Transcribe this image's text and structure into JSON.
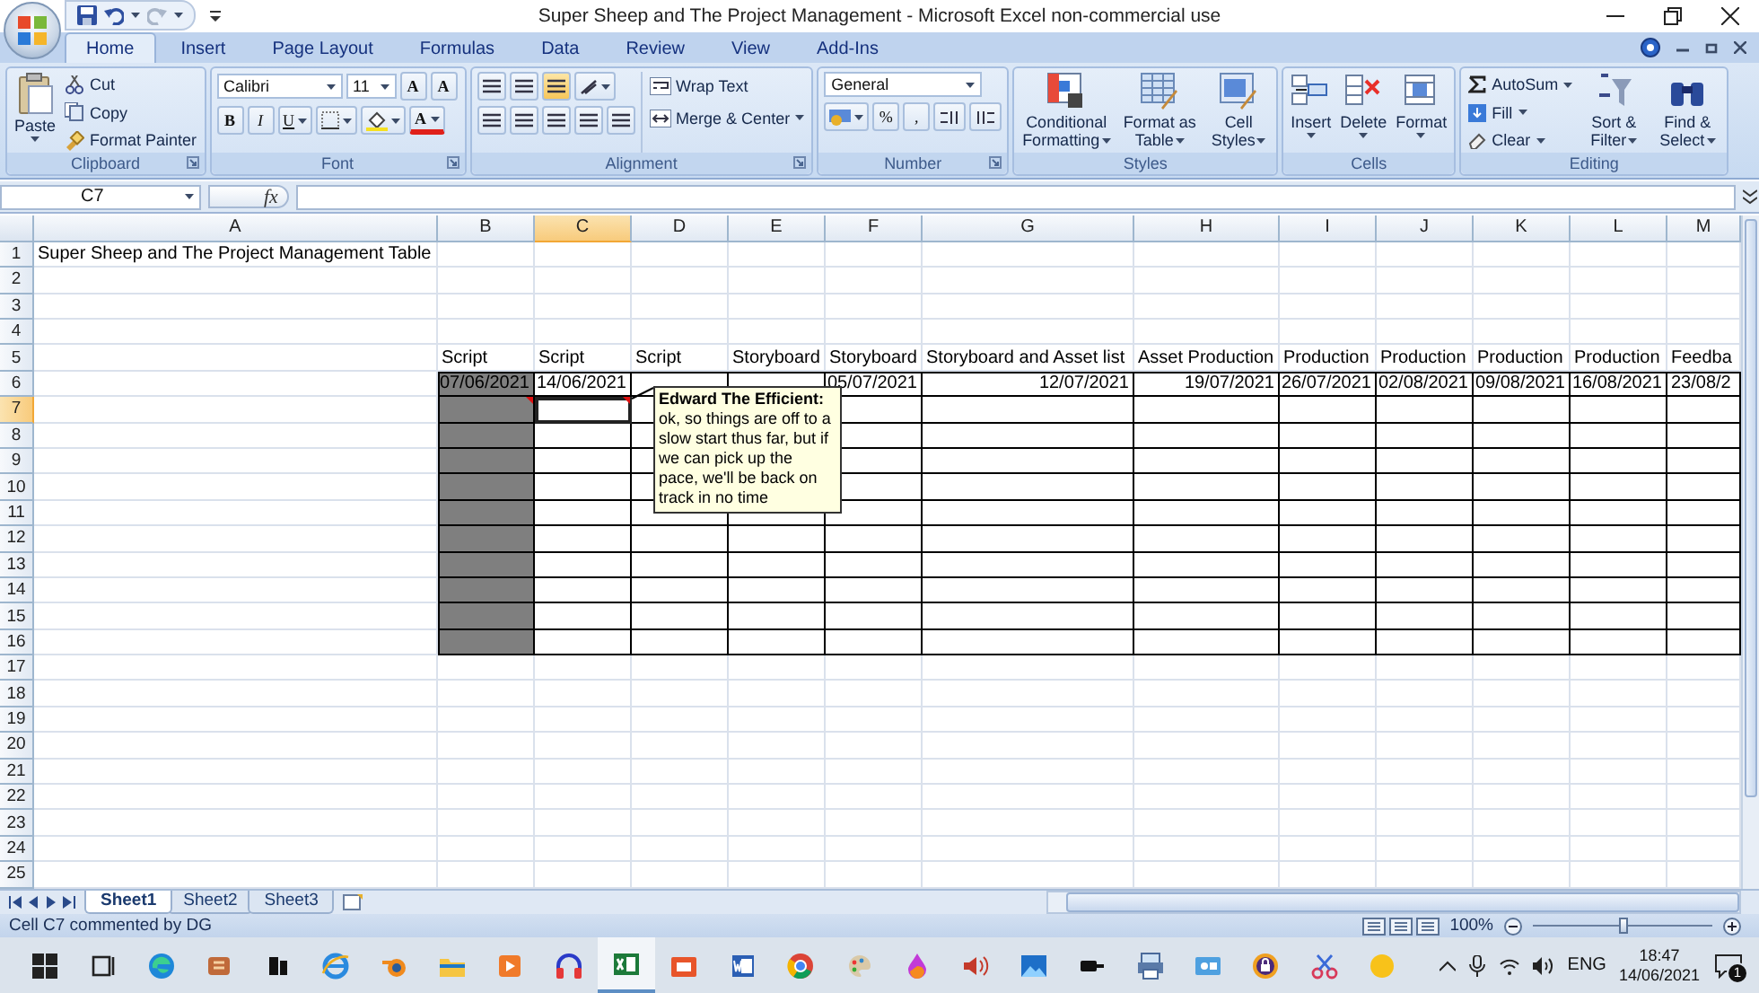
{
  "window": {
    "title": "Super Sheep and The Project Management - Microsoft Excel non-commercial use"
  },
  "tabs": [
    {
      "label": "Home",
      "selected": true
    },
    {
      "label": "Insert",
      "selected": false
    },
    {
      "label": "Page Layout",
      "selected": false
    },
    {
      "label": "Formulas",
      "selected": false
    },
    {
      "label": "Data",
      "selected": false
    },
    {
      "label": "Review",
      "selected": false
    },
    {
      "label": "View",
      "selected": false
    },
    {
      "label": "Add-Ins",
      "selected": false
    }
  ],
  "ribbon": [
    {
      "kind": "clipboard",
      "label": "Clipboard",
      "paste": "Paste",
      "items": [
        "Cut",
        "Copy",
        "Format Painter"
      ]
    },
    {
      "kind": "font",
      "label": "Font",
      "font": "Calibri",
      "size": "11",
      "grow": "A",
      "shrink": "A",
      "bold": "B",
      "italic": "I",
      "underline": "U",
      "font_color_label": "A"
    },
    {
      "kind": "alignment",
      "label": "Alignment",
      "wrap": "Wrap Text",
      "merge": "Merge & Center"
    },
    {
      "kind": "number",
      "label": "Number",
      "format": "General",
      "percent": "%",
      "comma": ","
    },
    {
      "kind": "large",
      "label": "Styles",
      "buttons": [
        "Conditional Formatting",
        "Format as Table",
        "Cell Styles"
      ]
    },
    {
      "kind": "large",
      "label": "Cells",
      "buttons": [
        "Insert",
        "Delete",
        "Format"
      ]
    },
    {
      "kind": "editing",
      "label": "Editing",
      "items": [
        "AutoSum",
        "Fill",
        "Clear"
      ],
      "buttons": [
        "Sort & Filter",
        "Find & Select"
      ]
    }
  ],
  "formula_bar": {
    "name_box": "C7",
    "function_button": "fx"
  },
  "columns": [
    {
      "label": "A",
      "selected": false
    },
    {
      "label": "B",
      "selected": false
    },
    {
      "label": "C",
      "selected": true
    },
    {
      "label": "D",
      "selected": false
    },
    {
      "label": "E",
      "selected": false
    },
    {
      "label": "F",
      "selected": false
    },
    {
      "label": "G",
      "selected": false
    },
    {
      "label": "H",
      "selected": false
    },
    {
      "label": "I",
      "selected": false
    },
    {
      "label": "J",
      "selected": false
    },
    {
      "label": "K",
      "selected": false
    },
    {
      "label": "L",
      "selected": false
    },
    {
      "label": "M",
      "selected": false
    }
  ],
  "rows": [
    {
      "label": "1",
      "selected": false,
      "bordered": false,
      "cells": [
        {
          "text": "Super Sheep and The Project Management Table"
        }
      ]
    },
    {
      "label": "2",
      "selected": false,
      "bordered": false
    },
    {
      "label": "3",
      "selected": false,
      "bordered": false
    },
    {
      "label": "4",
      "selected": false,
      "bordered": false
    },
    {
      "label": "5",
      "selected": false,
      "bordered": false,
      "cells": [
        {},
        {
          "text": "Script"
        },
        {
          "text": "Script"
        },
        {
          "text": "Script"
        },
        {
          "text": "Storyboard"
        },
        {
          "text": "Storyboard"
        },
        {
          "text": "Storyboard and Asset list"
        },
        {
          "text": "Asset Production"
        },
        {
          "text": "Production"
        },
        {
          "text": "Production"
        },
        {
          "text": "Production"
        },
        {
          "text": "Production"
        },
        {
          "text": "Feedba"
        }
      ]
    },
    {
      "label": "6",
      "selected": false,
      "bordered": true,
      "cells": [
        {},
        {
          "text": "07/06/2021",
          "kind": "date",
          "shaded": true
        },
        {
          "text": "14/06/2021",
          "kind": "date"
        },
        {},
        {},
        {
          "text": "05/07/2021",
          "kind": "date"
        },
        {
          "text": "12/07/2021",
          "kind": "date"
        },
        {
          "text": "19/07/2021",
          "kind": "date"
        },
        {
          "text": "26/07/2021",
          "kind": "date"
        },
        {
          "text": "02/08/2021",
          "kind": "date"
        },
        {
          "text": "09/08/2021",
          "kind": "date"
        },
        {
          "text": "16/08/2021",
          "kind": "date"
        },
        {
          "text": "23/08/2"
        }
      ]
    },
    {
      "label": "7",
      "selected": true,
      "bordered": true,
      "cells": [
        {},
        {
          "shaded": true,
          "commented": true
        },
        {
          "selected": true,
          "commented": true
        }
      ]
    },
    {
      "label": "8",
      "selected": false,
      "bordered": true,
      "cells": [
        {},
        {
          "shaded": true
        }
      ]
    },
    {
      "label": "9",
      "selected": false,
      "bordered": true,
      "cells": [
        {},
        {
          "shaded": true
        }
      ]
    },
    {
      "label": "10",
      "selected": false,
      "bordered": true,
      "cells": [
        {},
        {
          "shaded": true
        }
      ]
    },
    {
      "label": "11",
      "selected": false,
      "bordered": true,
      "cells": [
        {},
        {
          "shaded": true
        }
      ]
    },
    {
      "label": "12",
      "selected": false,
      "bordered": true,
      "cells": [
        {},
        {
          "shaded": true
        }
      ]
    },
    {
      "label": "13",
      "selected": false,
      "bordered": true,
      "cells": [
        {},
        {
          "shaded": true
        }
      ]
    },
    {
      "label": "14",
      "selected": false,
      "bordered": true,
      "cells": [
        {},
        {
          "shaded": true
        }
      ]
    },
    {
      "label": "15",
      "selected": false,
      "bordered": true,
      "cells": [
        {},
        {
          "shaded": true
        }
      ]
    },
    {
      "label": "16",
      "selected": false,
      "bordered": true,
      "cells": [
        {},
        {
          "shaded": true
        }
      ]
    },
    {
      "label": "17",
      "selected": false,
      "bordered": false
    },
    {
      "label": "18",
      "selected": false,
      "bordered": false
    },
    {
      "label": "19",
      "selected": false,
      "bordered": false
    },
    {
      "label": "20",
      "selected": false,
      "bordered": false
    },
    {
      "label": "21",
      "selected": false,
      "bordered": false
    },
    {
      "label": "22",
      "selected": false,
      "bordered": false
    },
    {
      "label": "23",
      "selected": false,
      "bordered": false
    },
    {
      "label": "24",
      "selected": false,
      "bordered": false
    },
    {
      "label": "25",
      "selected": false,
      "bordered": false
    }
  ],
  "comment": {
    "author": "Edward The Efficient:",
    "text": "ok, so things are off to a slow start thus far, but if we can pick up the pace, we'll be back on track in no time"
  },
  "sheets": [
    {
      "label": "Sheet1",
      "selected": true
    },
    {
      "label": "Sheet2",
      "selected": false
    },
    {
      "label": "Sheet3",
      "selected": false
    }
  ],
  "status_bar": {
    "message": "Cell C7 commented by DG",
    "zoom": "100%",
    "zoom_level": {
      "level": 0.5
    }
  },
  "taskbar": {
    "apps": [
      {
        "selected": false
      },
      {
        "selected": false
      },
      {
        "selected": false
      },
      {
        "selected": false
      },
      {
        "selected": false
      },
      {
        "selected": false
      },
      {
        "selected": false
      },
      {
        "selected": false
      },
      {
        "selected": false
      },
      {
        "selected": false
      },
      {
        "selected": true
      },
      {
        "selected": false
      },
      {
        "selected": false
      },
      {
        "selected": false
      },
      {
        "selected": false
      },
      {
        "selected": false
      },
      {
        "selected": false
      },
      {
        "selected": false
      },
      {
        "selected": false
      },
      {
        "selected": false
      },
      {
        "selected": false
      },
      {
        "selected": false
      },
      {
        "selected": false
      },
      {
        "selected": false
      }
    ],
    "language": "ENG",
    "time": "18:47",
    "date": "14/06/2021",
    "notifications": "1"
  }
}
